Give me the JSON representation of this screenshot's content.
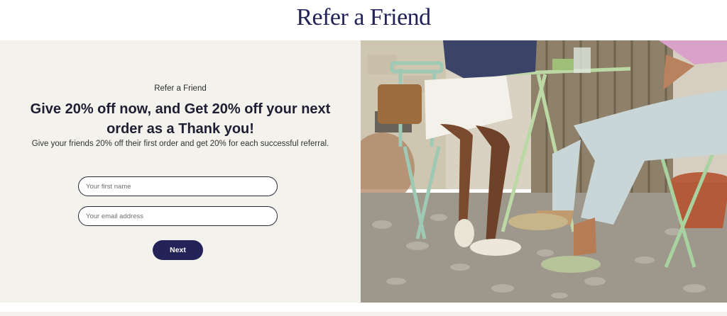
{
  "header": {
    "title": "Refer a Friend"
  },
  "form": {
    "eyebrow": "Refer a Friend",
    "headline": "Give 20% off now, and Get 20% off your next order as a Thank you!",
    "subtext": "Give your friends 20% off their first order and get 20% for each successful referral.",
    "first_name_placeholder": "Your first name",
    "email_placeholder": "Your email address",
    "next_label": "Next"
  },
  "colors": {
    "brand_navy": "#23235a",
    "panel_bg": "#f3f2ec"
  },
  "photo": {
    "subject": "lifestyle-photo"
  }
}
